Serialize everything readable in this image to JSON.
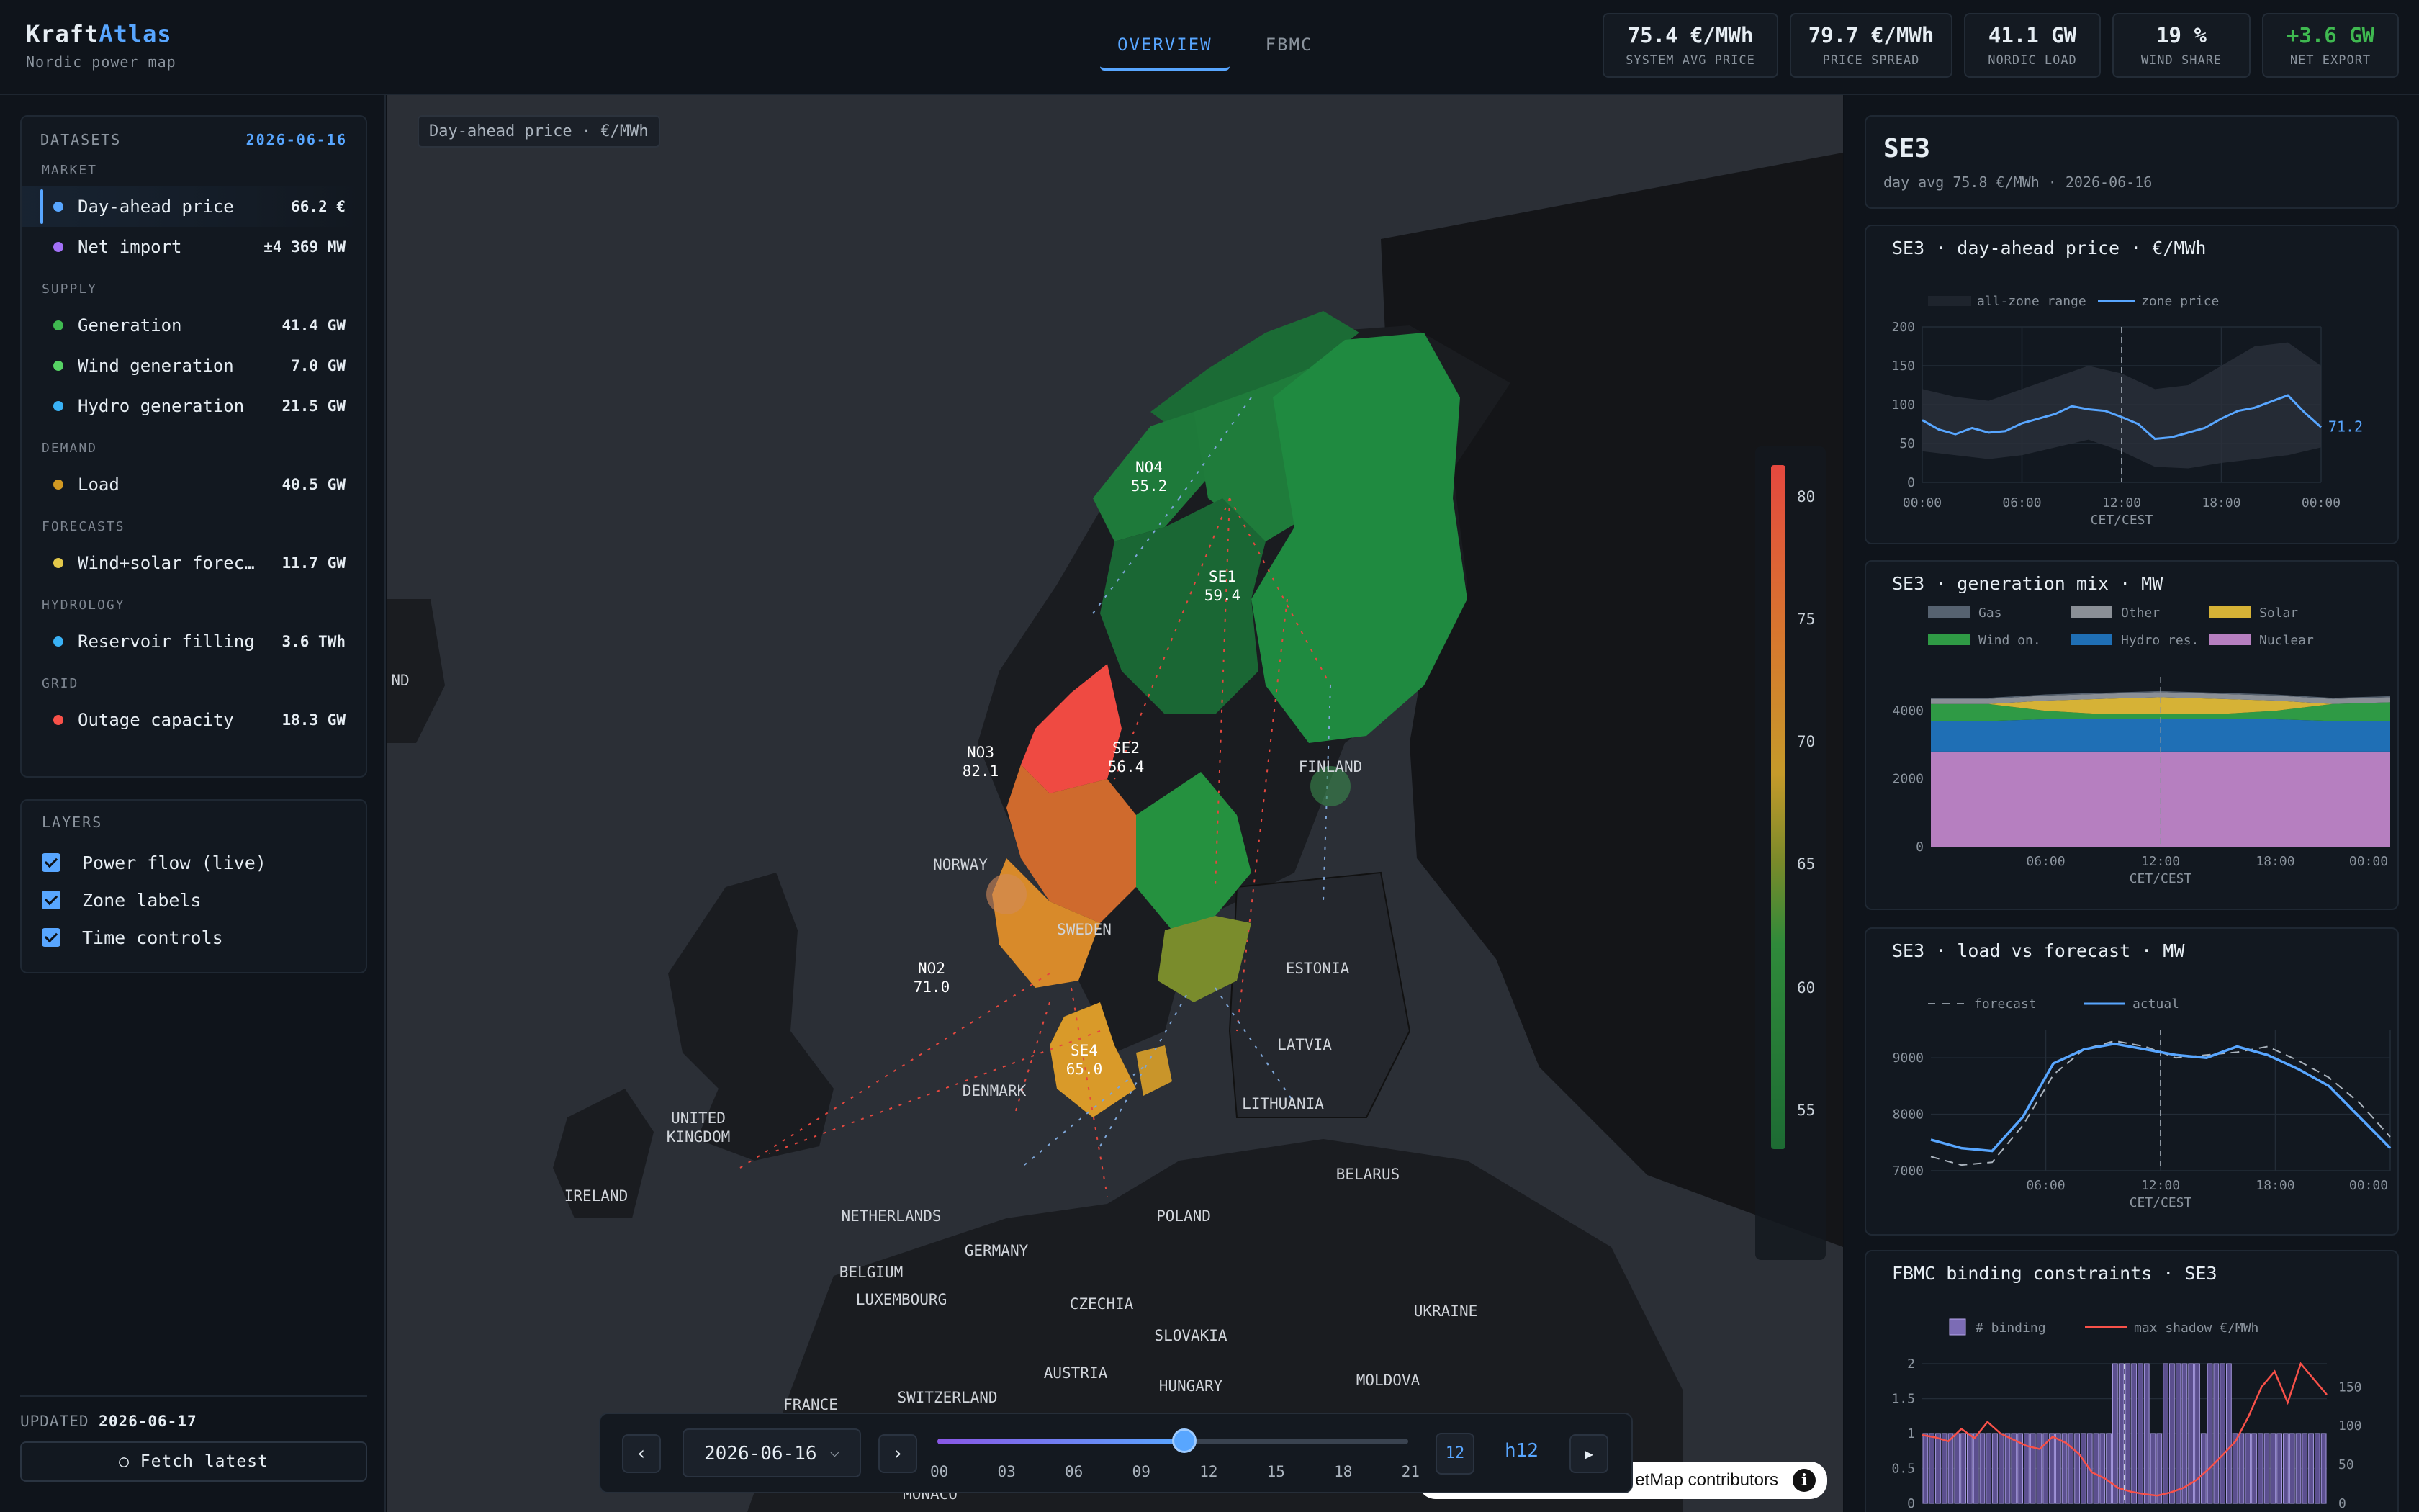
{
  "app": {
    "brand_a": "Kraft",
    "brand_b": "Atlas",
    "subtitle": "Nordic power map"
  },
  "tabs": [
    {
      "label": "OVERVIEW",
      "active": true
    },
    {
      "label": "FBMC",
      "active": false
    }
  ],
  "kpis": [
    {
      "value": "75.4 €/MWh",
      "label": "SYSTEM AVG PRICE"
    },
    {
      "value": "79.7 €/MWh",
      "label": "PRICE SPREAD"
    },
    {
      "value": "41.1 GW",
      "label": "NORDIC LOAD"
    },
    {
      "value": "19 %",
      "label": "WIND SHARE"
    },
    {
      "value": "+3.6 GW",
      "label": "NET EXPORT",
      "color": "#3fb950"
    }
  ],
  "datasets": {
    "title": "DATASETS",
    "date": "2026-06-16",
    "groups": [
      {
        "name": "MARKET",
        "items": [
          {
            "label": "Day-ahead price",
            "value": "66.2 €",
            "color": "#58a6ff",
            "active": true
          },
          {
            "label": "Net import",
            "value": "±4 369 MW",
            "color": "#a371f7"
          }
        ]
      },
      {
        "name": "SUPPLY",
        "items": [
          {
            "label": "Generation",
            "value": "41.4 GW",
            "color": "#3fb950"
          },
          {
            "label": "Wind generation",
            "value": "7.0 GW",
            "color": "#56d364"
          },
          {
            "label": "Hydro generation",
            "value": "21.5 GW",
            "color": "#39b1f5"
          }
        ]
      },
      {
        "name": "DEMAND",
        "items": [
          {
            "label": "Load",
            "value": "40.5 GW",
            "color": "#d29922"
          }
        ]
      },
      {
        "name": "FORECASTS",
        "items": [
          {
            "label": "Wind+solar forec…",
            "value": "11.7 GW",
            "color": "#e3c84a"
          }
        ]
      },
      {
        "name": "HYDROLOGY",
        "items": [
          {
            "label": "Reservoir filling",
            "value": "3.6 TWh",
            "color": "#39b1f5"
          }
        ]
      },
      {
        "name": "GRID",
        "items": [
          {
            "label": "Outage capacity",
            "value": "18.3 GW",
            "color": "#f85149"
          }
        ]
      }
    ]
  },
  "layers": {
    "title": "LAYERS",
    "items": [
      {
        "label": "Power flow (live)",
        "checked": true
      },
      {
        "label": "Zone labels",
        "checked": true
      },
      {
        "label": "Time controls",
        "checked": true
      }
    ]
  },
  "footer": {
    "updated_label": "UPDATED",
    "updated_date": "2026-06-17",
    "fetch_label": "○ Fetch latest"
  },
  "map": {
    "tag": "Day-ahead price · €/MWh",
    "legend_ticks": [
      "80",
      "75",
      "70",
      "65",
      "60",
      "55"
    ],
    "zones": [
      {
        "name": "NO4",
        "price": "55.2"
      },
      {
        "name": "SE1",
        "price": "59.4"
      },
      {
        "name": "NO3",
        "price": "82.1"
      },
      {
        "name": "SE2",
        "price": "56.4"
      },
      {
        "name": "NO2",
        "price": "71.0"
      },
      {
        "name": "SE4",
        "price": "65.0"
      }
    ],
    "countries": [
      "FINLAND",
      "NORWAY",
      "SWEDEN",
      "ESTONIA",
      "LATVIA",
      "LITHUANIA",
      "DENMARK",
      "UNITED",
      "KINGDOM",
      "IRELAND",
      "BELARUS",
      "NETHERLANDS",
      "POLAND",
      "GERMANY",
      "BELGIUM",
      "LUXEMBOURG",
      "CZECHIA",
      "SLOVAKIA",
      "UKRAINE",
      "AUSTRIA",
      "HUNGARY",
      "MOLDOVA",
      "FRANCE",
      "SWITZERLAND",
      "MONACO",
      "ND"
    ],
    "attribution": "etMap contributors"
  },
  "timebar": {
    "date": "2026-06-16",
    "ticks": [
      "00",
      "03",
      "06",
      "09",
      "12",
      "15",
      "18",
      "21"
    ],
    "hour": "12",
    "hour_label": "h12",
    "progress": 0.524
  },
  "zone": {
    "name": "SE3",
    "subtitle": "day avg 75.8 €/MWh · 2026-06-16"
  },
  "charts": {
    "price": {
      "title": "SE3 · day-ahead price · €/MWh",
      "legend": [
        "all-zone range",
        "zone price"
      ],
      "yticks": [
        "200",
        "150",
        "100",
        "50",
        "0"
      ],
      "xticks": [
        "00:00",
        "06:00",
        "12:00",
        "18:00",
        "00:00"
      ],
      "xlabel": "CET/CEST",
      "last_label": "71.2"
    },
    "mix": {
      "title": "SE3 · generation mix · MW",
      "legend": [
        "Gas",
        "Other",
        "Solar",
        "Wind on.",
        "Hydro res.",
        "Nuclear"
      ],
      "yticks": [
        "4000",
        "2000",
        "0"
      ],
      "xticks": [
        "06:00",
        "12:00",
        "18:00",
        "00:00"
      ],
      "xlabel": "CET/CEST"
    },
    "load": {
      "title": "SE3 · load vs forecast · MW",
      "legend": [
        "forecast",
        "actual"
      ],
      "yticks": [
        "9000",
        "8000",
        "7000"
      ],
      "xticks": [
        "06:00",
        "12:00",
        "18:00",
        "00:00"
      ],
      "xlabel": "CET/CEST"
    },
    "fbmc": {
      "title": "FBMC binding constraints · SE3",
      "legend": [
        "# binding",
        "max shadow €/MWh"
      ],
      "yticks": [
        "2",
        "1.5",
        "1",
        "0.5",
        "0"
      ],
      "y2ticks": [
        "150",
        "100",
        "50",
        "0"
      ],
      "xticks": [
        "00:00",
        "12:00"
      ]
    }
  },
  "chart_data": [
    {
      "type": "line",
      "title": "SE3 · day-ahead price · €/MWh",
      "xlabel": "CET/CEST",
      "ylim": [
        0,
        200
      ],
      "x_range": [
        "00:00",
        "24:00"
      ],
      "series": [
        {
          "name": "zone price",
          "x": [
            0,
            1,
            2,
            3,
            4,
            5,
            6,
            7,
            8,
            9,
            10,
            11,
            12,
            13,
            14,
            15,
            16,
            17,
            18,
            19,
            20,
            21,
            22,
            23,
            24
          ],
          "values": [
            80,
            68,
            62,
            70,
            64,
            66,
            76,
            82,
            88,
            98,
            94,
            92,
            84,
            75,
            56,
            58,
            64,
            70,
            82,
            92,
            96,
            104,
            112,
            90,
            71
          ]
        },
        {
          "name": "all-zone range",
          "x": [
            0,
            2,
            4,
            6,
            8,
            10,
            12,
            14,
            16,
            18,
            20,
            22,
            24
          ],
          "low": [
            40,
            35,
            30,
            35,
            45,
            55,
            40,
            20,
            18,
            25,
            30,
            35,
            45
          ],
          "high": [
            120,
            110,
            105,
            120,
            135,
            150,
            140,
            120,
            125,
            150,
            175,
            180,
            150
          ]
        }
      ]
    },
    {
      "type": "area",
      "title": "SE3 · generation mix · MW",
      "xlabel": "CET/CEST",
      "ylim": [
        0,
        5000
      ],
      "series": [
        {
          "name": "Nuclear",
          "values": [
            2800,
            2800,
            2800,
            2800,
            2800,
            2800,
            2800,
            2800,
            2800
          ]
        },
        {
          "name": "Hydro res.",
          "values": [
            900,
            900,
            950,
            950,
            950,
            950,
            950,
            900,
            900
          ]
        },
        {
          "name": "Wind on.",
          "values": [
            500,
            500,
            250,
            150,
            150,
            150,
            250,
            500,
            550
          ]
        },
        {
          "name": "Solar",
          "values": [
            0,
            0,
            300,
            450,
            500,
            450,
            300,
            0,
            0
          ]
        },
        {
          "name": "Other",
          "values": [
            150,
            150,
            150,
            150,
            150,
            150,
            150,
            150,
            150
          ]
        },
        {
          "name": "Gas",
          "values": [
            30,
            30,
            30,
            30,
            30,
            30,
            30,
            30,
            30
          ]
        }
      ]
    },
    {
      "type": "line",
      "title": "SE3 · load vs forecast · MW",
      "xlabel": "CET/CEST",
      "ylim": [
        7000,
        9500
      ],
      "series": [
        {
          "name": "forecast",
          "values": [
            7250,
            7100,
            7150,
            7800,
            8700,
            9150,
            9300,
            9200,
            9000,
            9050,
            9100,
            9200,
            8950,
            8650,
            8200,
            7600
          ]
        },
        {
          "name": "actual",
          "values": [
            7550,
            7400,
            7350,
            7950,
            8900,
            9150,
            9250,
            9150,
            9050,
            9000,
            9200,
            9050,
            8800,
            8500,
            7950,
            7400
          ]
        }
      ]
    },
    {
      "type": "bar",
      "title": "FBMC binding constraints · SE3",
      "ylim": [
        0,
        2
      ],
      "y2lim": [
        0,
        180
      ],
      "series": [
        {
          "name": "# binding",
          "values": [
            1,
            1,
            1,
            1,
            1,
            1,
            1,
            1,
            1,
            1,
            1,
            1,
            1,
            1,
            1,
            1,
            1,
            1,
            1,
            1,
            1,
            1,
            1,
            1,
            1,
            1,
            1,
            1,
            1,
            1,
            2,
            2,
            2,
            2,
            2,
            2,
            1,
            1,
            2,
            2,
            2,
            2,
            2,
            2,
            1,
            2,
            2,
            2,
            2,
            1,
            1,
            1,
            1,
            1,
            1,
            1,
            1,
            1,
            1,
            1,
            1,
            1,
            1,
            1
          ]
        },
        {
          "name": "max shadow €/MWh",
          "values": [
            88,
            85,
            80,
            96,
            84,
            105,
            90,
            82,
            74,
            70,
            86,
            78,
            64,
            40,
            32,
            20,
            15,
            12,
            10,
            14,
            20,
            30,
            45,
            62,
            80,
            112,
            150,
            170,
            130,
            180,
            160,
            140
          ]
        }
      ]
    }
  ]
}
